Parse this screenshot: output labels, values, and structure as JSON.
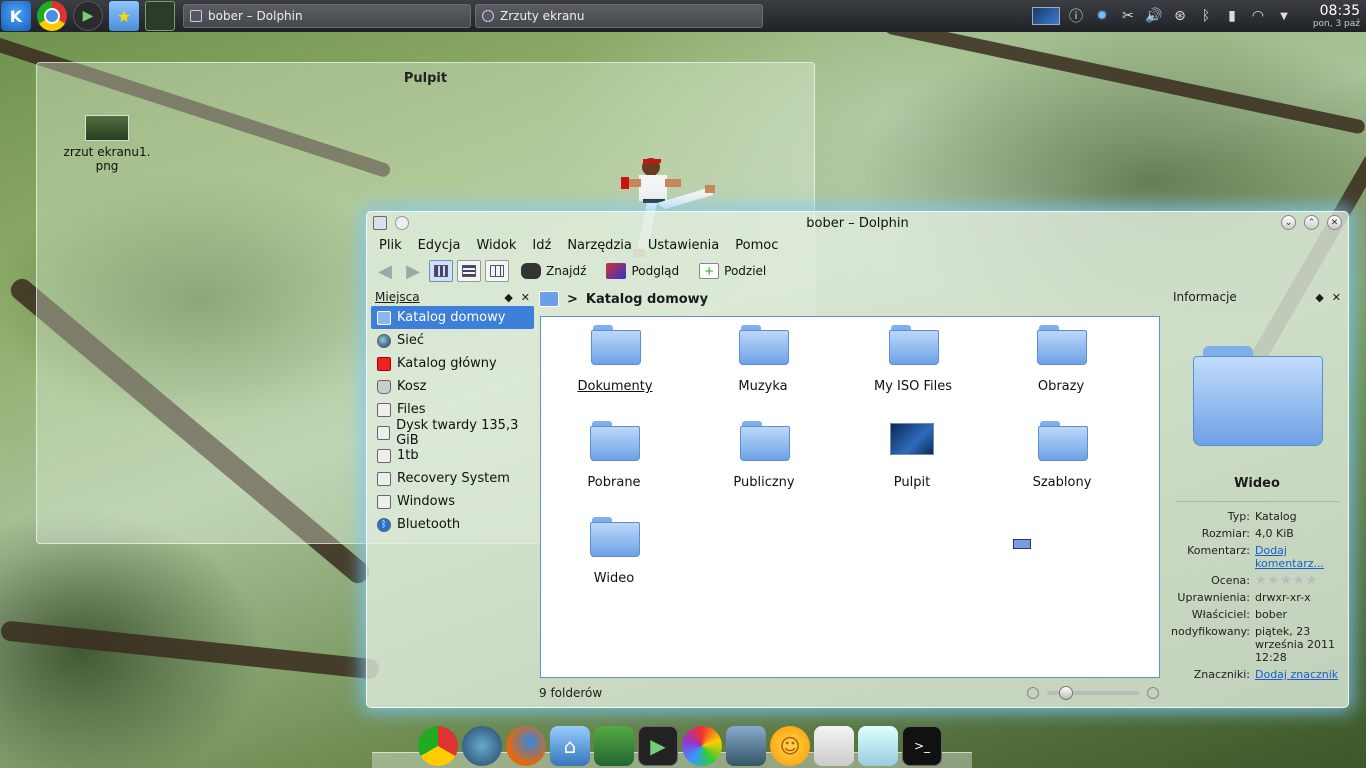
{
  "taskbar": {
    "tasks": [
      {
        "label": "bober – Dolphin"
      },
      {
        "label": "Zrzuty ekranu"
      }
    ],
    "clock": {
      "time": "08:35",
      "date": "pon, 3 paź"
    }
  },
  "desktop": {
    "widget_title": "Pulpit",
    "file": {
      "name": "zrzut ekranu1.\npng"
    }
  },
  "dolphin": {
    "title": "bober – Dolphin",
    "menu": [
      "Plik",
      "Edycja",
      "Widok",
      "Idź",
      "Narzędzia",
      "Ustawienia",
      "Pomoc"
    ],
    "toolbar": {
      "find": "Znajdź",
      "preview": "Podgląd",
      "split": "Podziel"
    },
    "places": {
      "title": "Miejsca",
      "items": [
        {
          "label": "Katalog domowy",
          "icon": "home-icon"
        },
        {
          "label": "Sieć",
          "icon": "network-icon"
        },
        {
          "label": "Katalog główny",
          "icon": "root-folder-icon"
        },
        {
          "label": "Kosz",
          "icon": "trash-icon"
        },
        {
          "label": "Files",
          "icon": "drive-icon"
        },
        {
          "label": "Dysk twardy 135,3 GiB",
          "icon": "drive-icon"
        },
        {
          "label": "1tb",
          "icon": "drive-icon"
        },
        {
          "label": "Recovery System",
          "icon": "drive-icon"
        },
        {
          "label": "Windows",
          "icon": "drive-icon"
        },
        {
          "label": "Bluetooth",
          "icon": "bluetooth-icon"
        }
      ]
    },
    "breadcrumb": {
      "current": "Katalog domowy"
    },
    "files": [
      {
        "name": "Dokumenty"
      },
      {
        "name": "Muzyka"
      },
      {
        "name": "My ISO Files"
      },
      {
        "name": "Obrazy"
      },
      {
        "name": "Pobrane"
      },
      {
        "name": "Publiczny"
      },
      {
        "name": "Pulpit"
      },
      {
        "name": "Szablony"
      },
      {
        "name": "Wideo"
      }
    ],
    "status": "9 folderów",
    "zoom_level": 0.15,
    "info": {
      "title": "Informacje",
      "name": "Wideo",
      "type_label": "Typ:",
      "type": "Katalog",
      "size_label": "Rozmiar:",
      "size": "4,0 KiB",
      "comment_label": "Komentarz:",
      "comment": "Dodaj komentarz...",
      "rating_label": "Ocena:",
      "rating": 0,
      "perm_label": "Uprawnienia:",
      "perm": "drwxr-xr-x",
      "owner_label": "Właściciel:",
      "owner": "bober",
      "modified_label": "nodyfikowany:",
      "modified": "piątek, 23 września 2011 12:28",
      "tags_label": "Znaczniki:",
      "tags": "Dodaj znacznik"
    }
  }
}
